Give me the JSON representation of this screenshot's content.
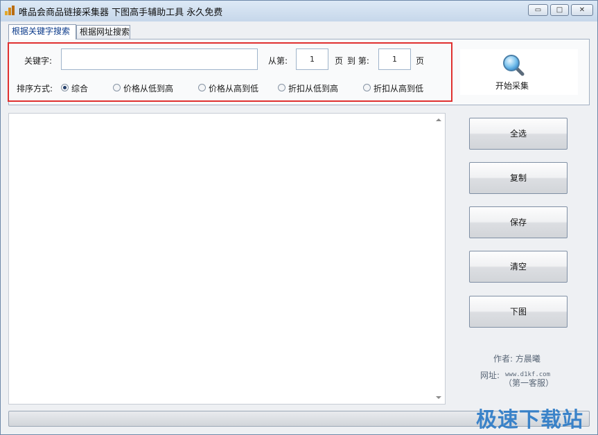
{
  "window": {
    "title": "唯品会商品链接采集器  下图高手辅助工具  永久免费",
    "minimize_glyph": "▭",
    "maximize_glyph": "□",
    "close_glyph": "✕"
  },
  "tabs": [
    {
      "label": "根据关键字搜索",
      "active": true
    },
    {
      "label": "根据网址搜索",
      "active": false
    }
  ],
  "form": {
    "keyword_label": "关键字:",
    "keyword_value": "",
    "from_label": "从第:",
    "from_value": "1",
    "page_label": "页",
    "to_label": "到  第:",
    "to_value": "1",
    "page_label_2": "页",
    "sort_label": "排序方式:",
    "sort_options": [
      {
        "label": "综合",
        "checked": true
      },
      {
        "label": "价格从低到高",
        "checked": false
      },
      {
        "label": "价格从高到低",
        "checked": false
      },
      {
        "label": "折扣从低到高",
        "checked": false
      },
      {
        "label": "折扣从高到低",
        "checked": false
      }
    ]
  },
  "search": {
    "icon": "magnifier-icon",
    "label": "开始采集"
  },
  "buttons": {
    "select_all": "全选",
    "copy": "复制",
    "save": "保存",
    "clear": "清空",
    "download": "下图"
  },
  "info": {
    "author": "作者: 方晨曦",
    "site_label": "网址:",
    "site_url": "www.d1kf.com",
    "site_note": "（第一客服）"
  },
  "progress": {
    "fraction": 0
  },
  "watermark": "极速下载站",
  "colors": {
    "highlight": "#e0302f",
    "active_tab_text": "#0b3a8a",
    "watermark": "#2d7bc7"
  }
}
